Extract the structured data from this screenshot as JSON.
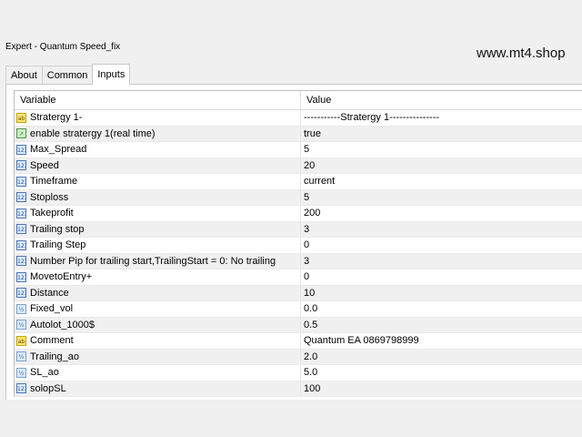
{
  "window": {
    "title": "Expert - Quantum Speed_fix"
  },
  "watermark": "www.mt4.shop",
  "tabs": [
    {
      "label": "About",
      "active": false
    },
    {
      "label": "Common",
      "active": false
    },
    {
      "label": "Inputs",
      "active": true
    }
  ],
  "table": {
    "headers": {
      "variable": "Variable",
      "value": "Value"
    },
    "rows": [
      {
        "icon": "string-icon",
        "variable": "Stratergy 1-",
        "value": "-----------Stratergy 1---------------"
      },
      {
        "icon": "bool-icon",
        "variable": "enable stratergy 1(real time)",
        "value": "true"
      },
      {
        "icon": "int-icon",
        "variable": "Max_Spread",
        "value": "5"
      },
      {
        "icon": "int-icon",
        "variable": "Speed",
        "value": "20"
      },
      {
        "icon": "int-icon",
        "variable": "Timeframe",
        "value": "current"
      },
      {
        "icon": "int-icon",
        "variable": "Stoploss",
        "value": "5"
      },
      {
        "icon": "int-icon",
        "variable": "Takeprofit",
        "value": "200"
      },
      {
        "icon": "int-icon",
        "variable": "Trailing stop",
        "value": "3"
      },
      {
        "icon": "int-icon",
        "variable": "Trailing Step",
        "value": "0"
      },
      {
        "icon": "int-icon",
        "variable": "Number Pip for trailing start,TrailingStart = 0: No trailing",
        "value": "3"
      },
      {
        "icon": "int-icon",
        "variable": "MovetoEntry+",
        "value": "0"
      },
      {
        "icon": "int-icon",
        "variable": "Distance",
        "value": "10"
      },
      {
        "icon": "double-icon",
        "variable": "Fixed_vol",
        "value": "0.0"
      },
      {
        "icon": "double-icon",
        "variable": "Autolot_1000$",
        "value": "0.5"
      },
      {
        "icon": "string-icon",
        "variable": "Comment",
        "value": "Quantum EA 0869798999"
      },
      {
        "icon": "double-icon",
        "variable": "Trailing_ao",
        "value": "2.0"
      },
      {
        "icon": "double-icon",
        "variable": "SL_ao",
        "value": "5.0"
      },
      {
        "icon": "int-icon",
        "variable": "solopSL",
        "value": "100"
      }
    ]
  }
}
